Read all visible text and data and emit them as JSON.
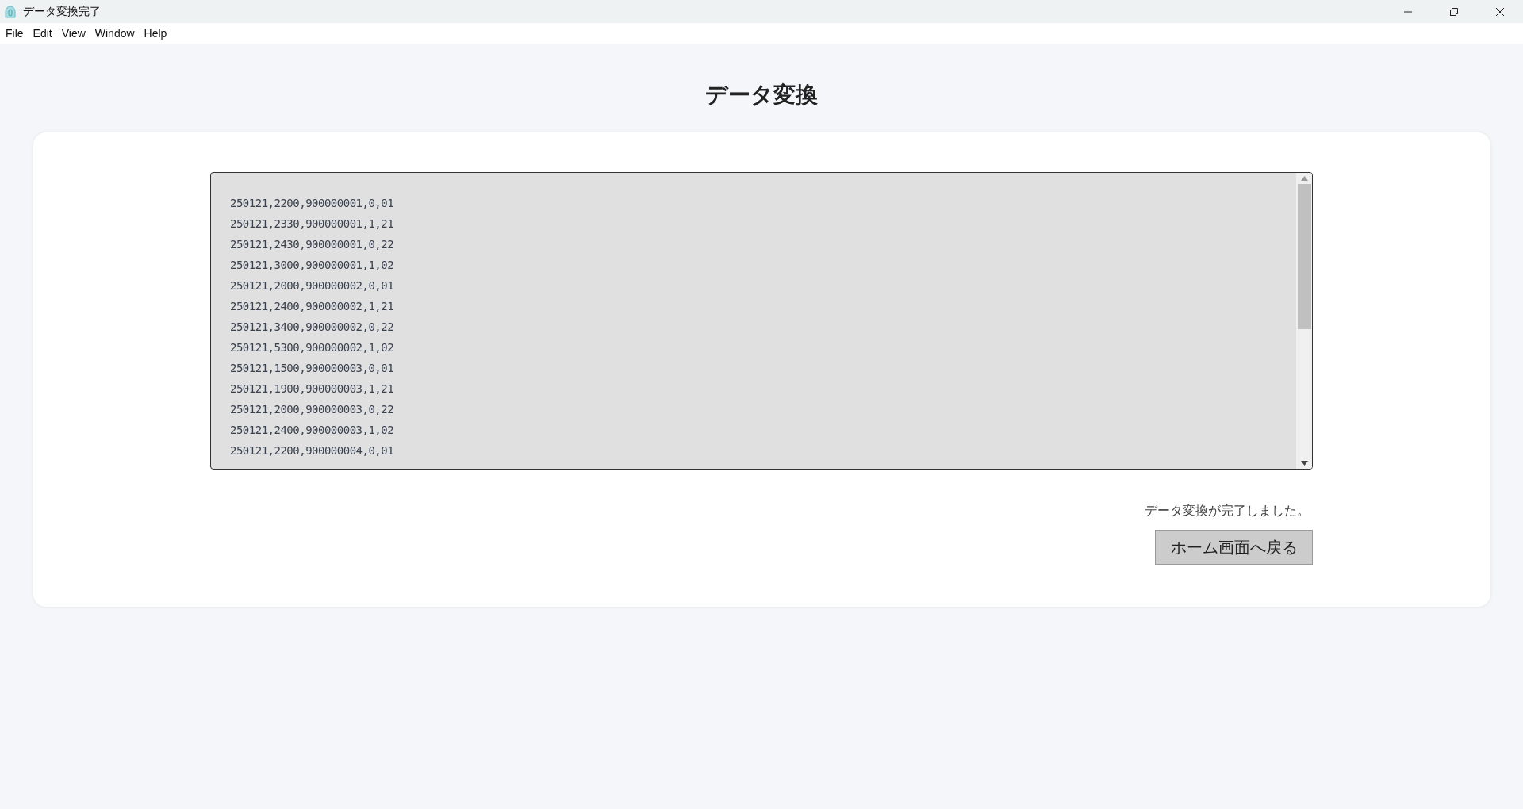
{
  "window": {
    "title": "データ変換完了"
  },
  "menu": [
    "File",
    "Edit",
    "View",
    "Window",
    "Help"
  ],
  "heading": "データ変換",
  "output_lines": [
    "250121,2200,900000001,0,01",
    "250121,2330,900000001,1,21",
    "250121,2430,900000001,0,22",
    "250121,3000,900000001,1,02",
    "250121,2000,900000002,0,01",
    "250121,2400,900000002,1,21",
    "250121,3400,900000002,0,22",
    "250121,5300,900000002,1,02",
    "250121,1500,900000003,0,01",
    "250121,1900,900000003,1,21",
    "250121,2000,900000003,0,22",
    "250121,2400,900000003,1,02",
    "250121,2200,900000004,0,01"
  ],
  "status_message": "データ変換が完了しました。",
  "home_button": "ホーム画面へ戻る"
}
